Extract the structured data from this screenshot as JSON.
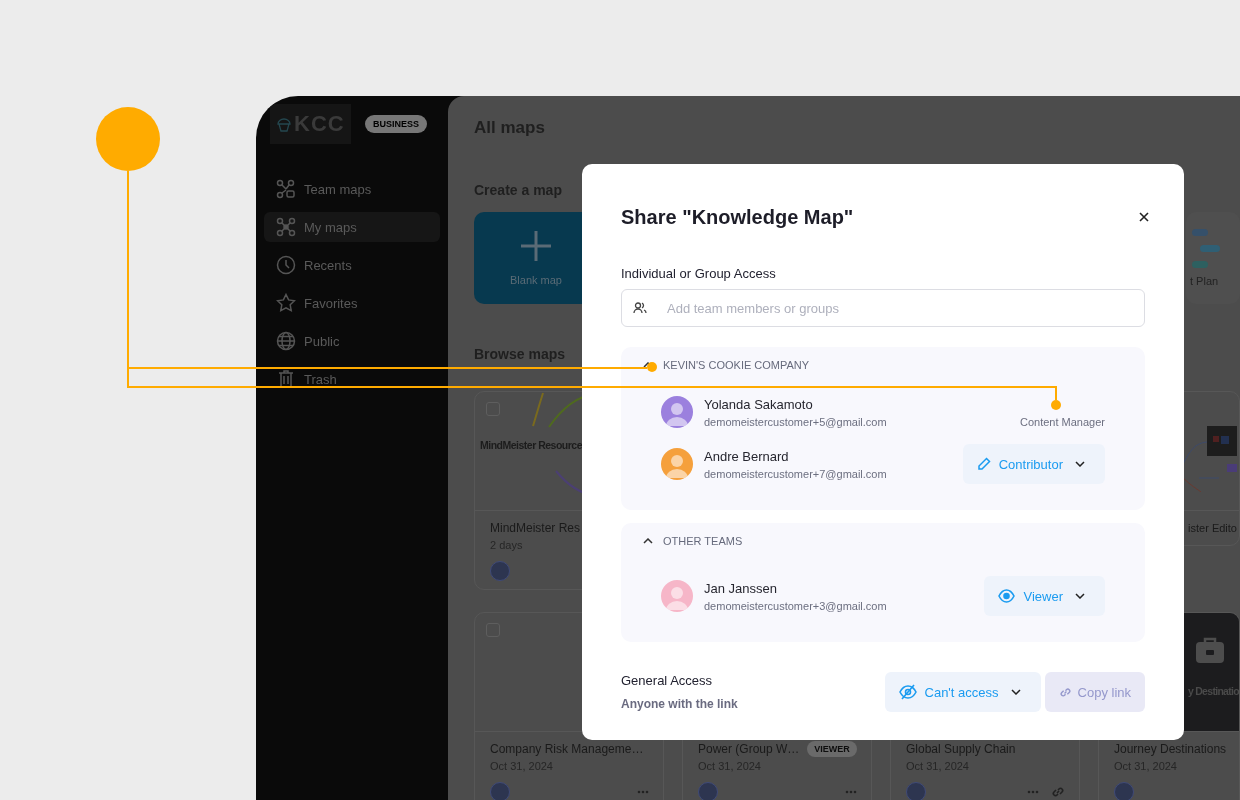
{
  "sidebar": {
    "logo": "KCC",
    "plan_badge": "BUSINESS",
    "items": [
      {
        "kind": "team",
        "label": "Team maps",
        "selected": false
      },
      {
        "kind": "mine",
        "label": "My maps",
        "selected": true
      },
      {
        "kind": "recent",
        "label": "Recents",
        "selected": false
      },
      {
        "kind": "favorite",
        "label": "Favorites",
        "selected": false
      },
      {
        "kind": "public",
        "label": "Public",
        "selected": false
      },
      {
        "kind": "trash",
        "label": "Trash",
        "selected": false
      }
    ]
  },
  "main": {
    "title": "All maps",
    "create_heading": "Create a map",
    "templates": [
      {
        "kind": "blank",
        "label": "Blank map"
      },
      {
        "kind": "plan",
        "label": "t Plan"
      }
    ],
    "browse_heading": "Browse maps",
    "card_rows": [
      {
        "cards": [
          {
            "kind": "curves",
            "thumbnail_label": "MindMeister Resource",
            "checked": false,
            "title": "MindMeister Res",
            "date": "2 days"
          },
          {
            "kind": "mindmap",
            "title": "ister Edito"
          }
        ]
      },
      {
        "cards": [
          {
            "kind": "plain",
            "checked": false,
            "title": "Company Risk Manageme…",
            "date": "Oct 31, 2024",
            "actions": [
              {
                "kind": "more"
              }
            ]
          },
          {
            "kind": "plain",
            "title": "Power (Group W…",
            "badge": "VIEWER",
            "date": "Oct 31, 2024",
            "actions": [
              {
                "kind": "more"
              }
            ]
          },
          {
            "kind": "plain",
            "title": "Global Supply Chain",
            "date": "Oct 31, 2024",
            "actions": [
              {
                "kind": "more"
              },
              {
                "kind": "link"
              }
            ]
          },
          {
            "kind": "briefcase",
            "thumbnail_label": "y Destinatio",
            "title": "Journey Destinations",
            "date": "Oct 31, 2024"
          }
        ]
      }
    ]
  },
  "share_dialog": {
    "title": "Share \"Knowledge Map\"",
    "access_label": "Individual or Group Access",
    "invite_field": {
      "placeholder": "Add team members or groups"
    },
    "groups": [
      {
        "name": "KEVIN'S COOKIE COMPANY",
        "expanded": true,
        "members": [
          {
            "name": "Yolanda Sakamoto",
            "email": "demomeistercustomer+5@gmail.com",
            "color": "#9b80de",
            "role": {
              "kind": "label",
              "text": "Content Manager"
            }
          },
          {
            "name": "Andre Bernard",
            "email": "demomeistercustomer+7@gmail.com",
            "color": "#f5a03c",
            "role": {
              "kind": "editor",
              "text": "Contributor"
            }
          }
        ]
      },
      {
        "name": "OTHER TEAMS",
        "expanded": true,
        "members": [
          {
            "name": "Jan Janssen",
            "email": "demomeistercustomer+3@gmail.com",
            "color": "#f6b6c8",
            "role": {
              "kind": "viewer",
              "text": "Viewer"
            }
          }
        ]
      }
    ],
    "general_access": {
      "label": "General Access",
      "description": "Anyone with the link",
      "access_button": {
        "kind": "no-access",
        "text": "Can't access"
      },
      "copy_link": {
        "text": "Copy link",
        "disabled": true
      }
    }
  }
}
